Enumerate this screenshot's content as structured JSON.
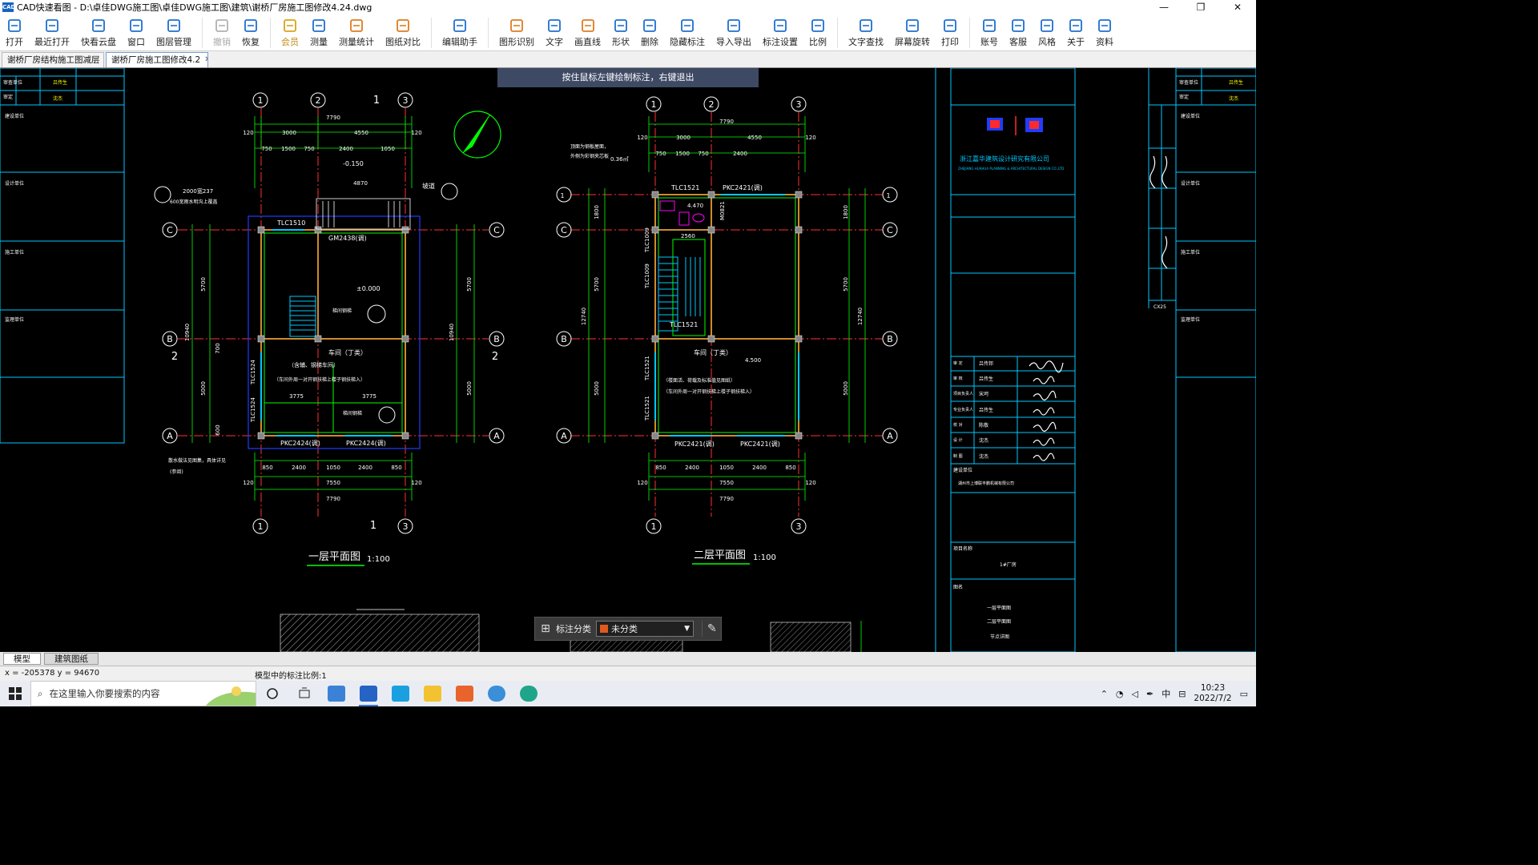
{
  "window": {
    "title": "CAD快速看图 - D:\\卓佳DWG施工图\\卓佳DWG施工图\\建筑\\谢桥厂房施工图修改4.24.dwg",
    "app_icon_text": "CAD",
    "controls": [
      "—",
      "❐",
      "✕"
    ]
  },
  "toolbar": {
    "items": [
      {
        "label": "打开",
        "icon": "folder-icon",
        "color": "#1e6fd0"
      },
      {
        "label": "最近打开",
        "icon": "history-icon",
        "color": "#1e6fd0"
      },
      {
        "label": "快看云盘",
        "icon": "cloud-icon",
        "color": "#1e6fd0"
      },
      {
        "label": "窗口",
        "icon": "window-icon",
        "color": "#1e6fd0"
      },
      {
        "label": "图层管理",
        "icon": "layers-icon",
        "color": "#1e6fd0"
      },
      {
        "label": "撤销",
        "icon": "undo-icon",
        "color": "#b0b0b0",
        "disabled": true
      },
      {
        "label": "恢复",
        "icon": "redo-icon",
        "color": "#1e6fd0"
      },
      {
        "label": "会员",
        "icon": "vip-icon",
        "color": "#d9a21b",
        "vip": true
      },
      {
        "label": "测量",
        "icon": "measure-icon",
        "color": "#1e6fd0"
      },
      {
        "label": "测量统计",
        "icon": "measure-stats-icon",
        "color": "#e07b1e"
      },
      {
        "label": "图纸对比",
        "icon": "compare-icon",
        "color": "#e07b1e"
      },
      {
        "label": "编辑助手",
        "icon": "edit-assistant-icon",
        "color": "#1e6fd0"
      },
      {
        "label": "图形识别",
        "icon": "shape-recognize-icon",
        "color": "#e07b1e"
      },
      {
        "label": "文字",
        "icon": "text-icon",
        "color": "#1e6fd0"
      },
      {
        "label": "画直线",
        "icon": "line-icon",
        "color": "#e07b1e"
      },
      {
        "label": "形状",
        "icon": "shape-icon",
        "color": "#1e6fd0"
      },
      {
        "label": "删除",
        "icon": "eraser-icon",
        "color": "#1e6fd0"
      },
      {
        "label": "隐藏标注",
        "icon": "hide-annotation-icon",
        "color": "#1e6fd0"
      },
      {
        "label": "导入导出",
        "icon": "import-export-icon",
        "color": "#1e6fd0"
      },
      {
        "label": "标注设置",
        "icon": "annotation-settings-icon",
        "color": "#1e6fd0"
      },
      {
        "label": "比例",
        "icon": "scale-icon",
        "color": "#1e6fd0"
      },
      {
        "label": "文字查找",
        "icon": "text-search-icon",
        "color": "#1e6fd0"
      },
      {
        "label": "屏幕旋转",
        "icon": "rotate-screen-icon",
        "color": "#1e6fd0"
      },
      {
        "label": "打印",
        "icon": "print-icon",
        "color": "#1e6fd0"
      },
      {
        "label": "账号",
        "icon": "account-icon",
        "color": "#1e6fd0"
      },
      {
        "label": "客服",
        "icon": "support-icon",
        "color": "#1e6fd0"
      },
      {
        "label": "风格",
        "icon": "style-icon",
        "color": "#1e6fd0"
      },
      {
        "label": "关于",
        "icon": "about-icon",
        "color": "#1e6fd0"
      },
      {
        "label": "资料",
        "icon": "resources-icon",
        "color": "#1e6fd0"
      }
    ]
  },
  "tabs": [
    {
      "label": "谢桥厂房结构施工图减层",
      "close": "✕",
      "active": false
    },
    {
      "label": "谢桥厂房施工图修改4.2",
      "close": "✕",
      "active": true
    }
  ],
  "canvas": {
    "hint": "按住鼠标左键绘制标注，右键退出",
    "plan1_title": "一层平面图",
    "plan1_scale": "1:100",
    "plan2_title": "二层平面图",
    "plan2_scale": "1:100",
    "axis_numbers": [
      "1",
      "2",
      "3"
    ],
    "axis_letters": [
      "A",
      "B",
      "C"
    ],
    "dims": {
      "total_width": "7790",
      "inner_width": "7550",
      "d3000": "3000",
      "d4550": "4550",
      "d120": "120",
      "d750": "750",
      "d1500": "1500",
      "d2400": "2400",
      "d1050": "1050",
      "d850": "850",
      "d5700": "5700",
      "d5000": "5000",
      "d10940": "10940",
      "d12740": "12740",
      "d1800": "1800",
      "d3775": "3775",
      "d700": "700",
      "d600": "600"
    },
    "plan1_labels": {
      "window_top": "TLC1510",
      "door": "GM2438(调)",
      "level_zero": "±0.000",
      "level_step": "-0.150",
      "depth": "4870",
      "room": "车间（丁类）",
      "room_sub": "（含辅、钢梯车间）",
      "note": "（车间外周一对开钢扶梯上楼子钢扶梯入）",
      "win_bottom_l": "PKC2424(调)",
      "win_bottom_r": "PKC2424(调)",
      "win_side_1": "TLC1524",
      "win_side_2": "TLC1524",
      "ramp": "坡道",
      "leader_1": "2000宽237",
      "leader_2": "600宽雨水明沟上覆盖",
      "leader_3": "散水做法见图集，具体详见",
      "leader_3b": "(参阅)",
      "section_2": "2",
      "stair_note": "梯间钢梯"
    },
    "plan2_labels": {
      "win_top_l": "TLC1521",
      "win_top_r": "PKC2421(调)",
      "door_wc": "M0821",
      "level_wc": "4.470",
      "level": "4.500",
      "area_note": "0.36㎡",
      "note_top_1": "顶面为钢板屋面，",
      "note_top_2": "外侧为彩钢夹芯板",
      "stair_w": "2560",
      "win_side_1": "TLC1009",
      "win_side_2": "TLC1009",
      "win_stair": "TLC1521",
      "win_side_3": "TLC1521",
      "win_side_4": "TLC1521",
      "room": "车间（丁类）",
      "room_note": "（楼面活、荷载及标准值见图纸）",
      "room_note_2": "（车间外周一对开钢扶梯上楼子钢扶梯入）",
      "win_bottom_l": "PKC2421(调)",
      "win_bottom_r": "PKC2421(调)"
    },
    "title_block": {
      "company": "浙江嘉华建筑设计研究有限公司",
      "company_en": "ZHEJIANG HUAHUA PLANNING & ARCHITECTURAL DESIGN CO.,LTD",
      "roles": [
        "审 定",
        "审 核",
        "项目负责人",
        "专业负责人",
        "校 对",
        "设 计",
        "制 图"
      ],
      "role_names": [
        "吕传邦",
        "吕传生",
        "宋坷",
        "吕传生",
        "陈敬",
        "沈杰",
        "沈杰"
      ],
      "project_label": "建设单位",
      "project_owner": "湖州市上博联丰鹏机械有限公司",
      "project_name_label": "项目名称",
      "project_name": "1#厂房",
      "drawing_label": "图名",
      "drawing_items": [
        "一层平面图",
        "二层平面图",
        "节点详图"
      ],
      "left_labels": [
        "审查单位",
        "审定",
        "建设单位",
        "设计单位",
        "施工单位",
        "监理单位"
      ],
      "left_names": [
        "吕传生",
        "沈杰"
      ],
      "drawing_no": "CX25"
    }
  },
  "annotation_box": {
    "label": "标注分类",
    "selected": "未分类",
    "swatch_color": "#e05a1e"
  },
  "model_tabs": [
    {
      "label": "模型",
      "active": true
    },
    {
      "label": "建筑图纸",
      "active": false
    }
  ],
  "status": {
    "coords": "x = -205378  y = 94670",
    "scale": "模型中的标注比例:1"
  },
  "taskbar": {
    "search_placeholder": "在这里输入你要搜索的内容",
    "time": "10:23",
    "date": "2022/7/2",
    "ime": "中",
    "apps": [
      "task-view-icon",
      "mail-app-icon",
      "cad-app-icon",
      "text-app-icon",
      "lightbulb-app-icon",
      "presentation-app-icon",
      "edge-app-icon",
      "browser-app-icon"
    ]
  },
  "colors": {
    "dim_green": "#00ff00",
    "wall_orange": "#d08a2c",
    "axis_red": "#ff3030",
    "text_white": "#ffffff",
    "cyan": "#00c8ff",
    "magenta": "#ff00ff"
  }
}
